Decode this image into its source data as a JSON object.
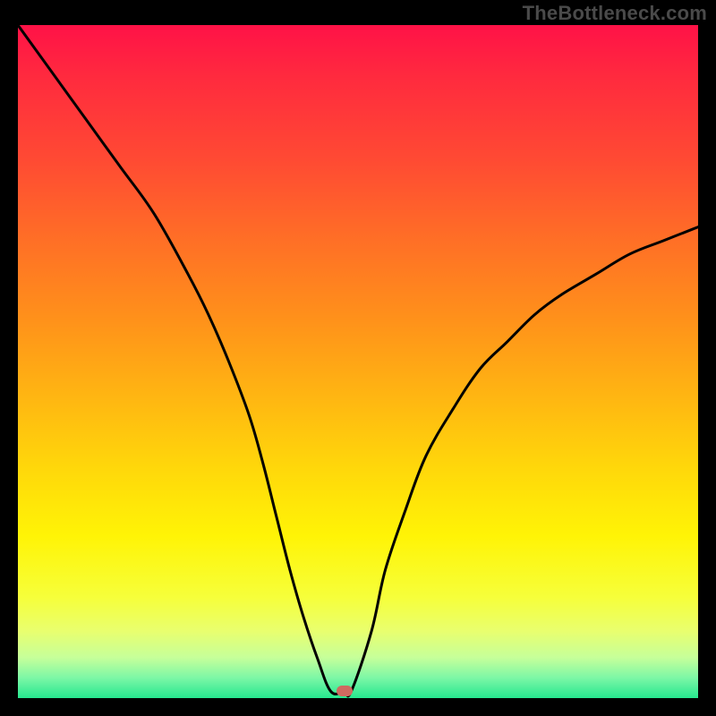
{
  "watermark": "TheBottleneck.com",
  "colors": {
    "frame": "#000000",
    "curve": "#000000",
    "marker": "#cf6a60",
    "gradient_stops": [
      "#ff1247",
      "#ff2b3e",
      "#ff4a33",
      "#ff6f26",
      "#ff921a",
      "#ffb512",
      "#ffd80a",
      "#fff406",
      "#f6ff3a",
      "#e9ff6e",
      "#c6ff9a",
      "#7cf7a6",
      "#26e78f"
    ]
  },
  "chart_data": {
    "type": "line",
    "title": "",
    "xlabel": "",
    "ylabel": "",
    "xlim": [
      0,
      100
    ],
    "ylim": [
      0,
      100
    ],
    "grid": false,
    "legend": false,
    "note": "x and y are percentages of the plot area; y=0 is bottom (green), y=100 is top (red). The curve is a V-shaped profile with a flat bottom and a marked minimum.",
    "series": [
      {
        "name": "curve",
        "x": [
          0,
          5,
          10,
          15,
          20,
          25,
          28,
          31,
          34,
          36,
          38,
          40,
          42,
          44,
          46,
          48,
          49,
          52,
          54,
          57,
          60,
          64,
          68,
          72,
          76,
          80,
          85,
          90,
          95,
          100
        ],
        "y": [
          100,
          93,
          86,
          79,
          72,
          63,
          57,
          50,
          42,
          35,
          27,
          19,
          12,
          6,
          1,
          1,
          1,
          10,
          19,
          28,
          36,
          43,
          49,
          53,
          57,
          60,
          63,
          66,
          68,
          70
        ]
      }
    ],
    "flat_bottom": {
      "x_start": 44,
      "x_end": 48,
      "y": 1
    },
    "marker": {
      "x": 48,
      "y": 1
    }
  }
}
